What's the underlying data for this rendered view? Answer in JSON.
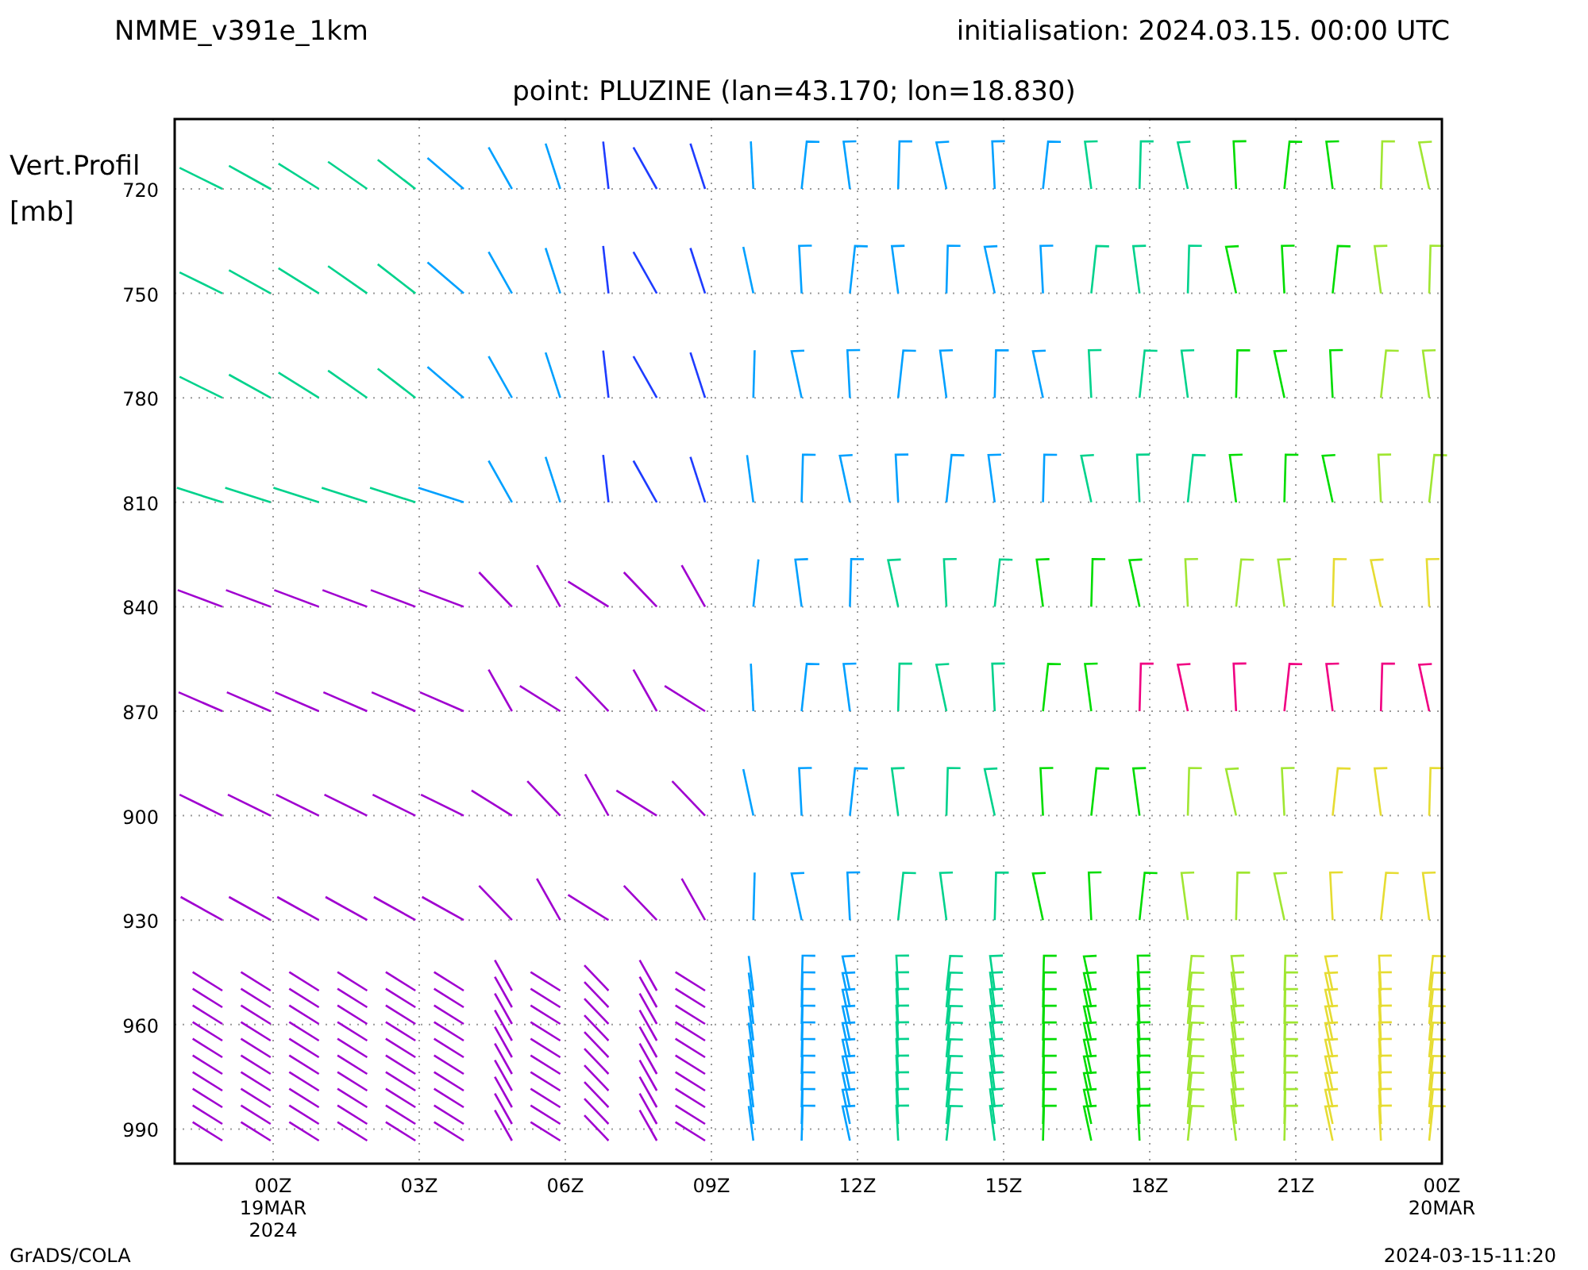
{
  "header": {
    "model": "NMME_v391e_1km",
    "initialisation": "initialisation: 2024.03.15. 00:00 UTC",
    "point": "point: PLUZINE (lan=43.170; lon=18.830)"
  },
  "y_axis": {
    "title": "Vert.Profil",
    "unit": "[mb]",
    "ticks": [
      "720",
      "750",
      "780",
      "810",
      "840",
      "870",
      "900",
      "930",
      "960",
      "990"
    ]
  },
  "x_axis": {
    "ticks": [
      {
        "label": "00Z",
        "date": "19MAR",
        "year": "2024"
      },
      {
        "label": "03Z"
      },
      {
        "label": "06Z"
      },
      {
        "label": "09Z"
      },
      {
        "label": "12Z"
      },
      {
        "label": "15Z"
      },
      {
        "label": "18Z"
      },
      {
        "label": "21Z"
      },
      {
        "label": "00Z",
        "date": "20MAR"
      }
    ]
  },
  "footer": {
    "left": "GrADS/COLA",
    "right": "2024-03-15-11:20"
  }
}
